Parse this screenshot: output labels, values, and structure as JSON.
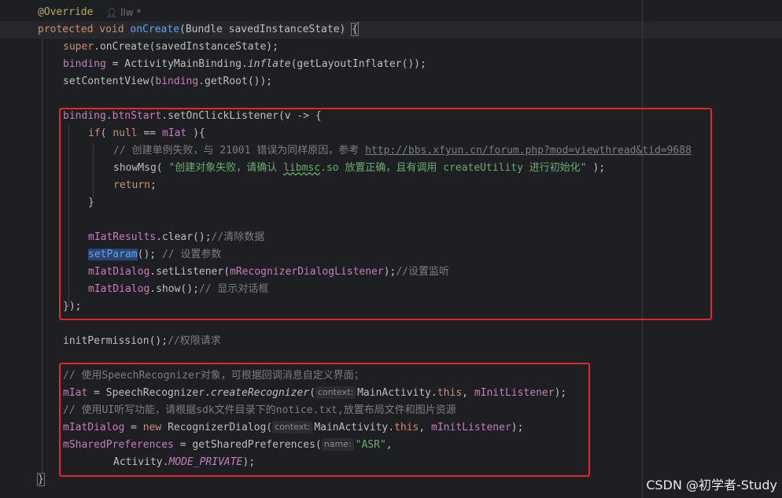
{
  "editor": {
    "author_hint": "llw *",
    "lines": {
      "l1": "@Override",
      "l2a": "protected void ",
      "l2b": "onCreate",
      "l2c": "(Bundle savedInstanceState) ",
      "l2d": "{",
      "l3a": "super",
      "l3b": ".onCreate(savedInstanceState);",
      "l4a": "binding",
      "l4b": " = ActivityMainBinding.",
      "l4c": "inflate",
      "l4d": "(getLayoutInflater());",
      "l5a": "setContentView(",
      "l5b": "binding",
      "l5c": ".getRoot());",
      "l6a": "binding",
      "l6b": ".",
      "l6c": "btnStart",
      "l6d": ".setOnClickListener(v -> {",
      "l7a": "if",
      "l7b": "( ",
      "l7c": "null",
      "l7d": " == ",
      "l7e": "mIat",
      "l7f": " ){",
      "l8a": "// 创建单例失败，与 21001 错误为同样原因，参考 ",
      "l8b": "http://bbs.xfyun.cn/forum.php?mod=viewthread&tid=9688",
      "l9a": "showMsg( ",
      "l9b": "\"创建对象失败，请确认 ",
      "l9c": "libmsc",
      "l9d": ".so 放置正确，且有调用 createUtility 进行初始化\"",
      "l9e": " );",
      "l10": "return",
      "l10b": ";",
      "l11": "}",
      "l12a": "mIatResults",
      "l12b": ".clear();",
      "l12c": "//清除数据",
      "l13a": "setParam",
      "l13b": "(); ",
      "l13c": "// 设置参数",
      "l14a": "mIatDialog",
      "l14b": ".setListener(",
      "l14c": "mRecognizerDialogListener",
      "l14d": ");",
      "l14e": "//设置监听",
      "l15a": "mIatDialog",
      "l15b": ".show();",
      "l15c": "// 显示对话框",
      "l16": "});",
      "l17a": "initPermission();",
      "l17b": "//权限请求",
      "l18": "// 使用SpeechRecognizer对象，可根据回调消息自定义界面；",
      "l19a": "mIat",
      "l19b": " = SpeechRecognizer.",
      "l19c": "createRecognizer",
      "l19d": "(",
      "l19h": "context:",
      "l19e": "MainActivity.",
      "l19f": "this",
      "l19g": ", ",
      "l19i": "mInitListener",
      "l19j": ");",
      "l20": "// 使用UI听写功能，请根据sdk文件目录下的notice.txt,放置布局文件和图片资源",
      "l21a": "mIatDialog",
      "l21b": " = ",
      "l21c": "new",
      "l21d": " RecognizerDialog(",
      "l21h": "context:",
      "l21e": "MainActivity.",
      "l21f": "this",
      "l21g": ", ",
      "l21i": "mInitListener",
      "l21j": ");",
      "l22a": "mSharedPreferences",
      "l22b": " = getSharedPreferences(",
      "l22h": "name:",
      "l22c": "\"ASR\"",
      "l22d": ",",
      "l23a": "Activity.",
      "l23b": "MODE_PRIVATE",
      "l23c": ");",
      "l24": "}"
    }
  },
  "watermark": "CSDN @初学者-Study",
  "colors": {
    "highlight_box": "#e3262a",
    "background": "#1e1f22"
  }
}
